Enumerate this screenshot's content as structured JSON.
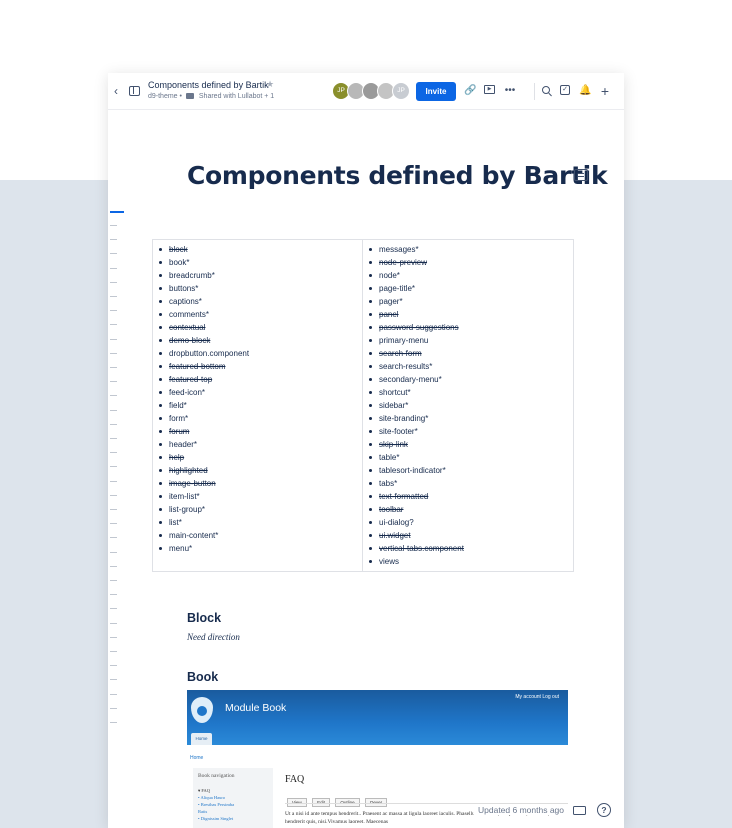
{
  "topbar": {
    "back_icon": "chevron-left-icon",
    "title": "Components defined by Bartik",
    "star": "★",
    "space": "d9-theme",
    "separator": "•",
    "shared": "Shared with Lullabot + 1",
    "avatars": [
      {
        "initials": "JP"
      },
      {
        "initials": ""
      },
      {
        "initials": ""
      },
      {
        "initials": ""
      },
      {
        "initials": "JP"
      }
    ],
    "invite_label": "Invite",
    "link_glyph": "🔗",
    "present_glyph": "▶",
    "more_glyph": "•••",
    "check_glyph": "✓",
    "bell_glyph": "🔔",
    "plus_glyph": "+"
  },
  "page": {
    "title": "Components defined by Bartik",
    "components_left": [
      {
        "text": "block",
        "struck": true
      },
      {
        "text": "book*",
        "struck": false
      },
      {
        "text": "breadcrumb*",
        "struck": false
      },
      {
        "text": "buttons*",
        "struck": false
      },
      {
        "text": "captions*",
        "struck": false
      },
      {
        "text": "comments*",
        "struck": false
      },
      {
        "text": "contextual",
        "struck": true
      },
      {
        "text": "demo-block",
        "struck": true
      },
      {
        "text": "dropbutton.component",
        "struck": false
      },
      {
        "text": "featured-bottom",
        "struck": true
      },
      {
        "text": "featured-top",
        "struck": true
      },
      {
        "text": "feed-icon*",
        "struck": false
      },
      {
        "text": "field*",
        "struck": false
      },
      {
        "text": "form*",
        "struck": false
      },
      {
        "text": "forum",
        "struck": true
      },
      {
        "text": "header*",
        "struck": false
      },
      {
        "text": "help",
        "struck": true
      },
      {
        "text": "highlighted",
        "struck": true
      },
      {
        "text": "image-button",
        "struck": true
      },
      {
        "text": "item-list*",
        "struck": false
      },
      {
        "text": "list-group*",
        "struck": false
      },
      {
        "text": "list*",
        "struck": false
      },
      {
        "text": "main-content*",
        "struck": false
      },
      {
        "text": "menu*",
        "struck": false
      }
    ],
    "components_right": [
      {
        "text": "messages*",
        "struck": false
      },
      {
        "text": "node-preview",
        "struck": true
      },
      {
        "text": "node*",
        "struck": false
      },
      {
        "text": "page-title*",
        "struck": false
      },
      {
        "text": "pager*",
        "struck": false
      },
      {
        "text": "panel",
        "struck": true
      },
      {
        "text": "password-suggestions",
        "struck": true
      },
      {
        "text": "primary-menu",
        "struck": false
      },
      {
        "text": "search-form",
        "struck": true
      },
      {
        "text": "search-results*",
        "struck": false
      },
      {
        "text": "secondary-menu*",
        "struck": false
      },
      {
        "text": "shortcut*",
        "struck": false
      },
      {
        "text": "sidebar*",
        "struck": false
      },
      {
        "text": "site-branding*",
        "struck": false
      },
      {
        "text": "site-footer*",
        "struck": false
      },
      {
        "text": "skip-link",
        "struck": true
      },
      {
        "text": "table*",
        "struck": false
      },
      {
        "text": "tablesort-indicator*",
        "struck": false
      },
      {
        "text": "tabs*",
        "struck": false
      },
      {
        "text": "text-formatted",
        "struck": true
      },
      {
        "text": "toolbar",
        "struck": true
      },
      {
        "text": "ui-dialog?",
        "struck": false
      },
      {
        "text": "ui.widget",
        "struck": true
      },
      {
        "text": "vertical-tabs.component",
        "struck": true
      },
      {
        "text": "views",
        "struck": false
      }
    ],
    "block_heading": "Block",
    "block_text": "Need direction",
    "book_heading": "Book"
  },
  "book_screenshot": {
    "site_name": "Module Book",
    "links": "My account    Log out",
    "tab": "Home",
    "crumb": "Home",
    "nav_title": "Book navigation",
    "nav_items": [
      "▾ FAQ",
      "• Aliqua Hauro",
      "• Bresthas Persimba",
      "  Ratis",
      "• Dignissim Singlet"
    ],
    "heading": "FAQ",
    "tabs": [
      "View",
      "Edit",
      "Outline",
      "Dever"
    ],
    "body": "Ut a nisi id ante tempus hendrerit.. Praesent ac massa at ligula laoreet iaculis. Phasellus leo dolor, tempus non, auctor et, hendrerit quis, nisi.Vivamus laoreet. Maecenas"
  },
  "footer": {
    "updated": "Updated 6 months ago",
    "help_glyph": "?"
  },
  "toc": {
    "dash_count": 36
  }
}
